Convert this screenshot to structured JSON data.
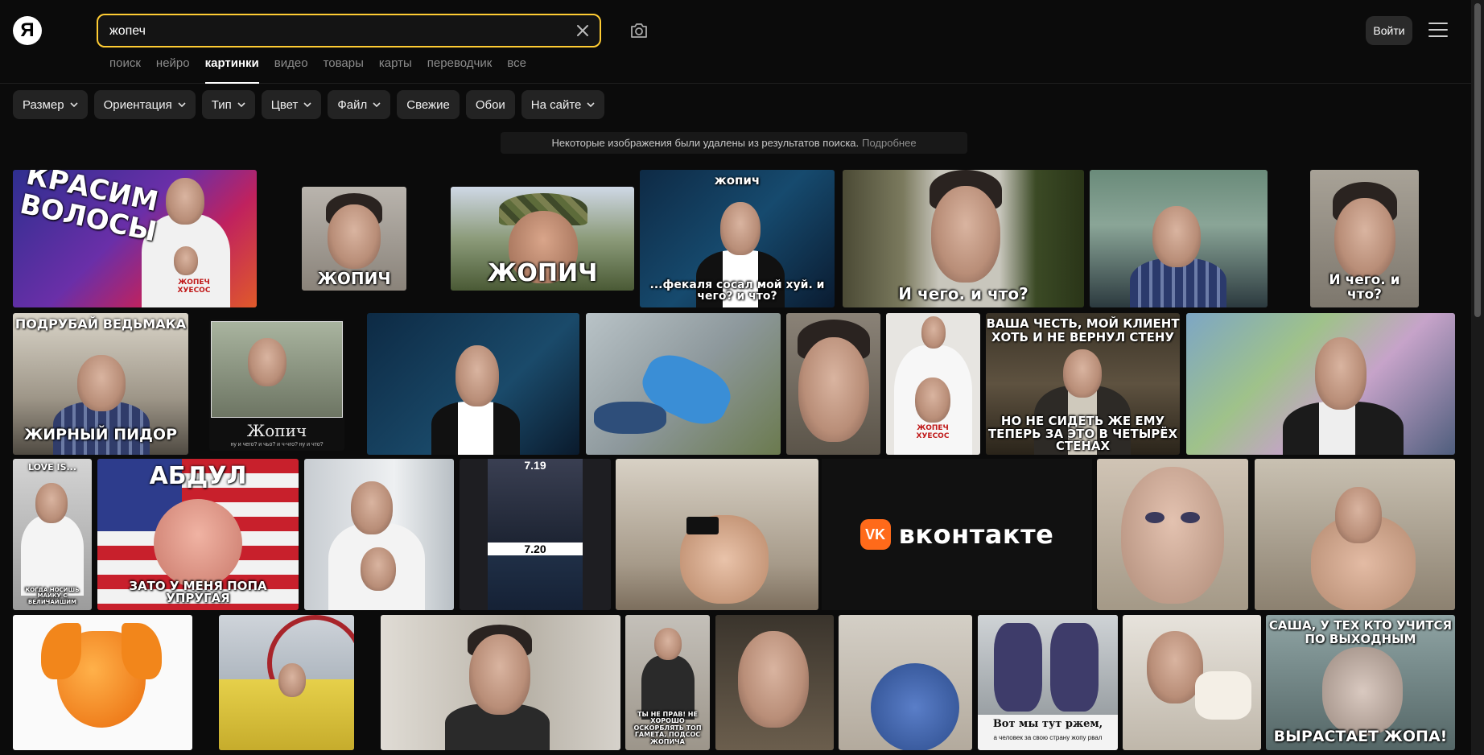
{
  "header": {
    "logo_text": "Я",
    "search_value": "жопеч",
    "login_label": "Войти"
  },
  "tabs": [
    {
      "label": "поиск",
      "active": false
    },
    {
      "label": "нейро",
      "active": false
    },
    {
      "label": "картинки",
      "active": true
    },
    {
      "label": "видео",
      "active": false
    },
    {
      "label": "товары",
      "active": false
    },
    {
      "label": "карты",
      "active": false
    },
    {
      "label": "переводчик",
      "active": false
    },
    {
      "label": "все",
      "active": false
    }
  ],
  "filters": [
    {
      "label": "Размер",
      "dropdown": true
    },
    {
      "label": "Ориентация",
      "dropdown": true
    },
    {
      "label": "Тип",
      "dropdown": true
    },
    {
      "label": "Цвет",
      "dropdown": true
    },
    {
      "label": "Файл",
      "dropdown": true
    },
    {
      "label": "Свежие",
      "dropdown": false
    },
    {
      "label": "Обои",
      "dropdown": false
    },
    {
      "label": "На сайте",
      "dropdown": true
    }
  ],
  "notice": {
    "text": "Некоторые изображения были удалены из результатов поиска.",
    "link": "Подробнее"
  },
  "vk": {
    "logo": "VK",
    "text": "вконтакте"
  },
  "captions": {
    "r1_1_top": "КРАСИМ ВОЛОСЫ",
    "r1_1_shirt": "ЖОПЕЧ ХУЕСОС",
    "r1_2": "ЖОПИЧ",
    "r1_3": "ЖОПИЧ",
    "r1_4_top": "жопич",
    "r1_4": "...фекаля сосал мой хуй. и чего? и что?",
    "r1_5": "И чего. и что?",
    "r1_7": "И чего. и что?",
    "r2_1_top": "ПОДРУБАЙ ВЕДЬМАКА",
    "r2_1": "ЖИРНЫЙ ПИДОР",
    "r2_2": "Жопич",
    "r2_2_sub": "ну и чего? и чьо? и ч-чго? ну и что?",
    "r2_6_shirt": "ЖОПЕЧ ХУЕСОС",
    "r2_7_top": "ВАША ЧЕСТЬ, МОЙ КЛИЕНТ ХОТЬ И НЕ ВЕРНУЛ СТЕНУ",
    "r2_7": "НО НЕ СИДЕТЬ ЖЕ ЕМУ ТЕПЕРЬ ЗА ЭТО В ЧЕТЫРЁХ СТЕНАХ",
    "r3_1_top": "LOVE IS...",
    "r3_1": "КОГДА НОСИШЬ МАЙКУ С ВЕЛИЧАЙШИМ",
    "r3_2_top": "АБДУЛ",
    "r3_2": "ЗАТО У МЕНЯ ПОПА УПРУГАЯ",
    "r3_4_a": "7.19",
    "r3_4_b": "7.20",
    "r4_4": "ТЫ НЕ ПРАВ! НЕ ХОРОШО ОСКОРБЛЯТЬ ТОП ГАМЕТА, ПОДСОС ЖОПИЧА",
    "r4_7": "Вот мы тут ржем,",
    "r4_7_sub": "а человек за свою страну жопу рвал",
    "r4_9_top": "САША, У ТЕХ КТО УЧИТСЯ ПО ВЫХОДНЫМ",
    "r4_9": "ВЫРАСТАЕТ ЖОПА!"
  }
}
